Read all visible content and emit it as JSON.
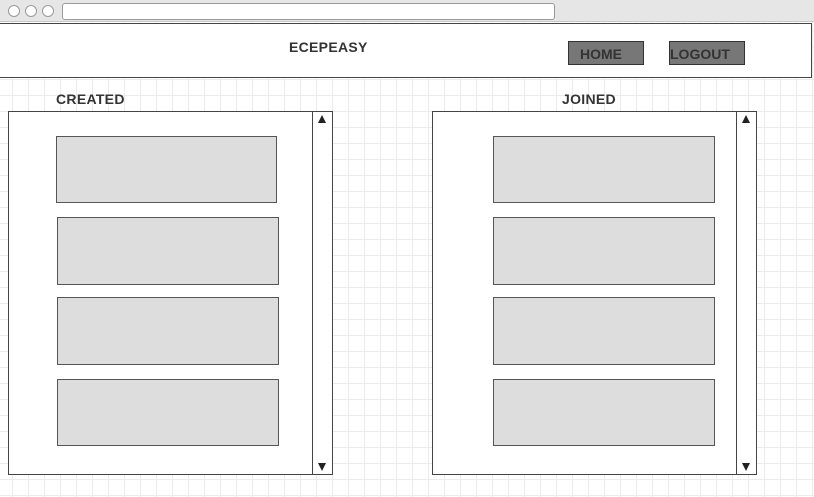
{
  "header": {
    "brand": "ECEPEASY",
    "home_label": "HOME",
    "logout_label": "LOGOUT"
  },
  "sections": {
    "created": {
      "label": "CREATED",
      "card_count": 4
    },
    "joined": {
      "label": "JOINED",
      "card_count": 4
    }
  },
  "colors": {
    "button_fill": "#777777",
    "card_fill": "#dddddd",
    "text": "#333333"
  }
}
